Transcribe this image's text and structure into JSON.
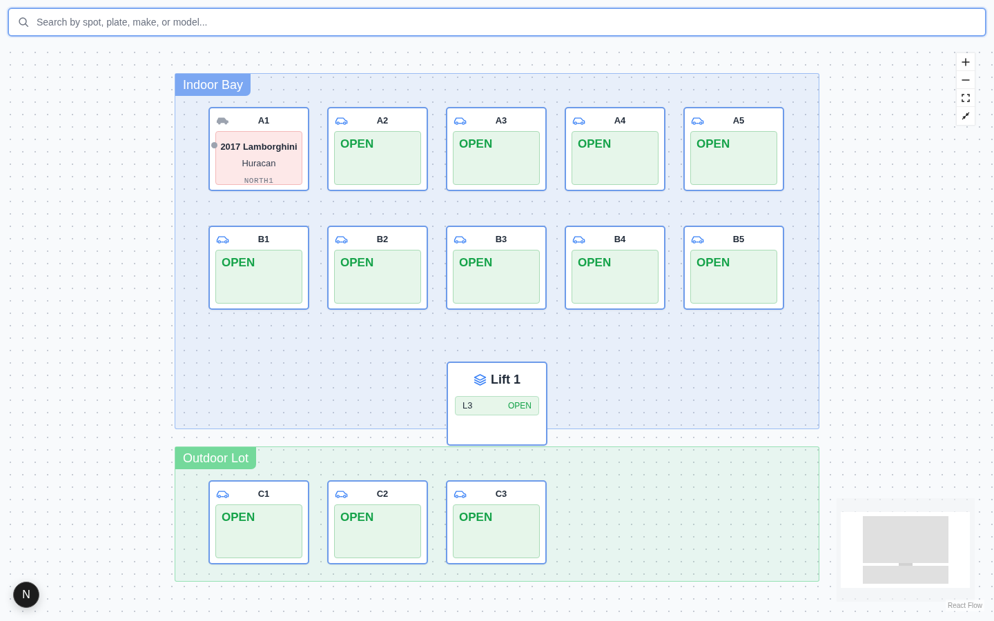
{
  "search": {
    "placeholder": "Search by spot, plate, make, or model..."
  },
  "zones": [
    {
      "name": "Indoor Bay",
      "color": "#7ba7f2",
      "spots": [
        {
          "label": "A1",
          "occupied": true,
          "vehicle": {
            "title": "2017 Lamborghini",
            "model": "Huracan",
            "plate": "NORTH1"
          }
        },
        {
          "label": "A2",
          "occupied": false,
          "status": "OPEN"
        },
        {
          "label": "A3",
          "occupied": false,
          "status": "OPEN"
        },
        {
          "label": "A4",
          "occupied": false,
          "status": "OPEN"
        },
        {
          "label": "A5",
          "occupied": false,
          "status": "OPEN"
        },
        {
          "label": "B1",
          "occupied": false,
          "status": "OPEN"
        },
        {
          "label": "B2",
          "occupied": false,
          "status": "OPEN"
        },
        {
          "label": "B3",
          "occupied": false,
          "status": "OPEN"
        },
        {
          "label": "B4",
          "occupied": false,
          "status": "OPEN"
        },
        {
          "label": "B5",
          "occupied": false,
          "status": "OPEN"
        }
      ]
    },
    {
      "name": "Outdoor Lot",
      "color": "#74d99b",
      "spots": [
        {
          "label": "C1",
          "occupied": false,
          "status": "OPEN"
        },
        {
          "label": "C2",
          "occupied": false,
          "status": "OPEN"
        },
        {
          "label": "C3",
          "occupied": false,
          "status": "OPEN"
        }
      ]
    }
  ],
  "lifts": [
    {
      "name": "Lift 1",
      "levels": [
        {
          "label": "L3",
          "status": "OPEN"
        }
      ]
    }
  ],
  "attribution": "React Flow",
  "dev_indicator": {
    "label": "N"
  }
}
